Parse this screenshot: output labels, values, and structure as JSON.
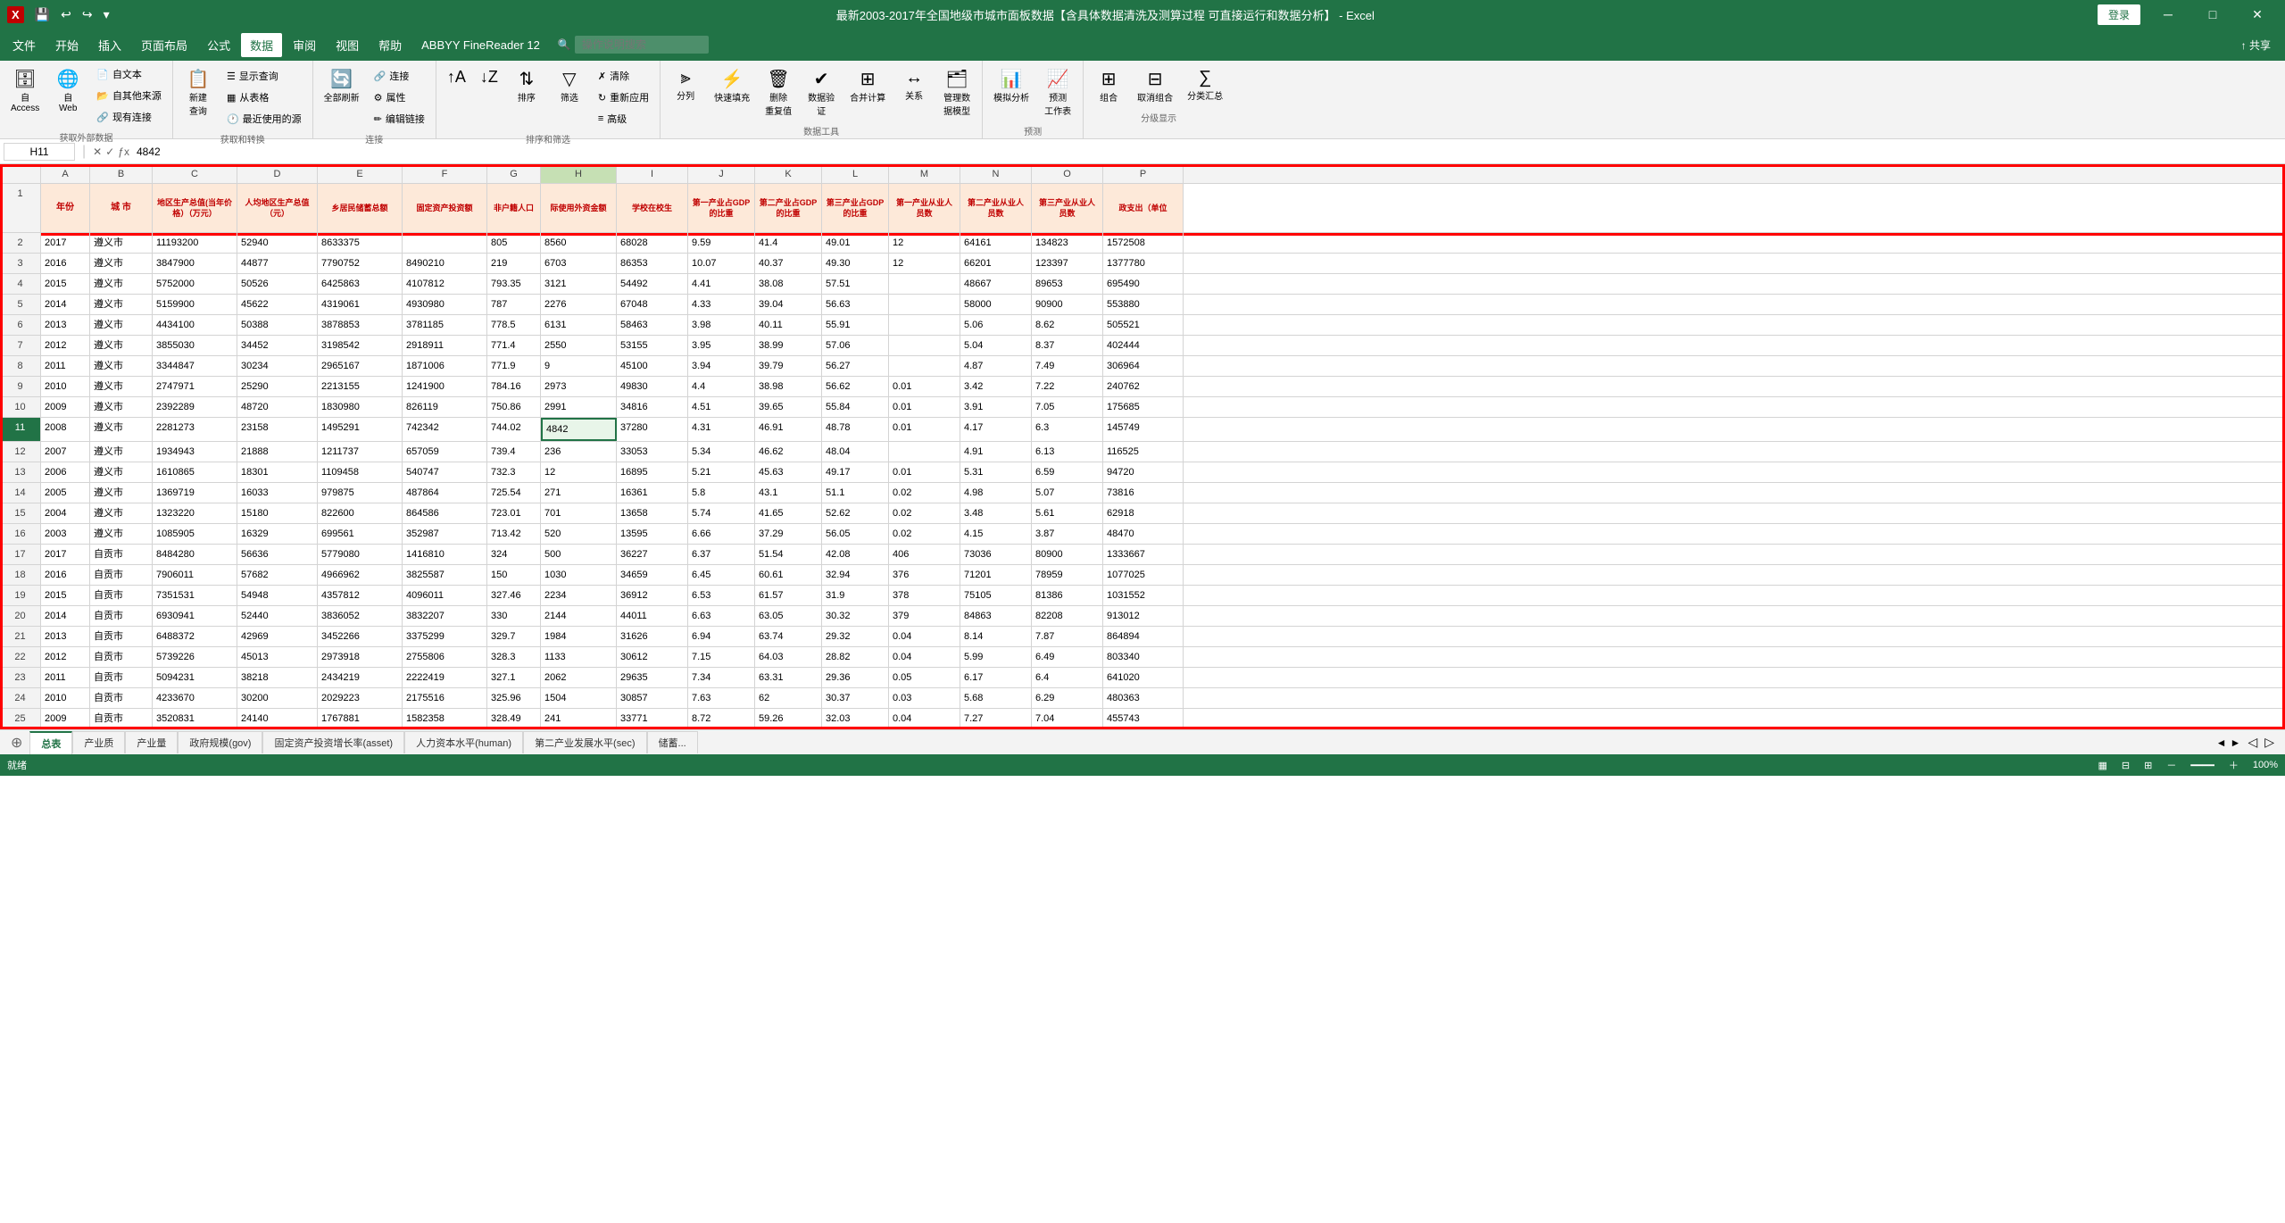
{
  "titleBar": {
    "title": "最新2003-2017年全国地级市城市面板数据【含具体数据清洗及测算过程 可直接运行和数据分析】 - Excel",
    "loginBtn": "登录",
    "windowControls": [
      "─",
      "□",
      "✕"
    ]
  },
  "menuBar": {
    "items": [
      "文件",
      "开始",
      "插入",
      "页面布局",
      "公式",
      "数据",
      "审阅",
      "视图",
      "帮助",
      "ABBYY FineReader 12",
      "操作说明搜索"
    ]
  },
  "ribbon": {
    "groups": [
      {
        "label": "获取外部数据",
        "buttons": [
          {
            "id": "access-btn",
            "icon": "🗄",
            "label": "自\nAccess"
          },
          {
            "id": "web-btn",
            "icon": "🌐",
            "label": "自\nWeb"
          },
          {
            "id": "text-btn",
            "icon": "📄",
            "label": "自文本"
          },
          {
            "id": "other-btn",
            "icon": "📂",
            "label": "自其他来源"
          },
          {
            "id": "existing-btn",
            "icon": "🔗",
            "label": "现有连接"
          }
        ]
      },
      {
        "label": "获取和转换",
        "buttons": [
          {
            "id": "new-query-btn",
            "icon": "📋",
            "label": "新建\n查询"
          },
          {
            "id": "show-query-btn",
            "label": "显示查询"
          },
          {
            "id": "from-table-btn",
            "label": "从表格"
          },
          {
            "id": "recent-btn",
            "label": "最近使用的源"
          }
        ]
      },
      {
        "label": "连接",
        "buttons": [
          {
            "id": "connect-btn",
            "label": "连接"
          },
          {
            "id": "props-btn",
            "label": "属性"
          },
          {
            "id": "edit-link-btn",
            "label": "编辑链接"
          },
          {
            "id": "refresh-all-btn",
            "icon": "🔄",
            "label": "全部刷新"
          }
        ]
      },
      {
        "label": "排序和筛选",
        "buttons": [
          {
            "id": "sort-asc-btn",
            "icon": "↑",
            "label": ""
          },
          {
            "id": "sort-desc-btn",
            "icon": "↓",
            "label": ""
          },
          {
            "id": "sort-btn",
            "icon": "⇅",
            "label": "排序"
          },
          {
            "id": "filter-btn",
            "icon": "▽",
            "label": "筛选"
          },
          {
            "id": "clear-btn",
            "label": "清除"
          },
          {
            "id": "reapply-btn",
            "label": "重新应用"
          },
          {
            "id": "advanced-btn",
            "label": "高级"
          }
        ]
      },
      {
        "label": "数据工具",
        "buttons": [
          {
            "id": "split-btn",
            "label": "分列"
          },
          {
            "id": "fill-btn",
            "label": "快速填充"
          },
          {
            "id": "remove-dup-btn",
            "label": "删除\n重复值"
          },
          {
            "id": "validate-btn",
            "label": "数据验\n证"
          },
          {
            "id": "consolidate-btn",
            "label": "合并计算"
          },
          {
            "id": "relations-btn",
            "label": "关系"
          },
          {
            "id": "manage-model-btn",
            "label": "管理数\n据模型"
          }
        ]
      },
      {
        "label": "预测",
        "buttons": [
          {
            "id": "what-if-btn",
            "label": "模拟分析"
          },
          {
            "id": "forecast-btn",
            "label": "预测\n工作表"
          }
        ]
      },
      {
        "label": "分级显示",
        "buttons": [
          {
            "id": "group-btn",
            "label": "组合"
          },
          {
            "id": "ungroup-btn",
            "label": "取消组合"
          },
          {
            "id": "subtotal-btn",
            "label": "分类汇总"
          }
        ]
      }
    ]
  },
  "formulaBar": {
    "cellRef": "H11",
    "formula": "4842"
  },
  "columns": [
    "A",
    "B",
    "C",
    "D",
    "E",
    "F",
    "G",
    "H",
    "I",
    "J",
    "K",
    "L",
    "M",
    "N",
    "O",
    "P"
  ],
  "headers": {
    "row1": [
      "年份",
      "城 市",
      "地区生产总值(当年价格）（万元）",
      "人均地区生产总值（元）",
      "乡居民储蓄总额",
      "固定资产投资额",
      "非户籍人口",
      "际使用外资金额",
      "学校在校生",
      "第一产业占GDP的比重",
      "第二产业占GDP的比重",
      "第三产业占GDP的比重",
      "第一产业从业人员数",
      "第二产业从业人员数",
      "第三产业从业人员数",
      "政支出（单位"
    ]
  },
  "rows": [
    {
      "num": 2,
      "cells": [
        "2017",
        "遵义市",
        "11193200",
        "52940",
        "8633375",
        "",
        "805",
        "8560",
        "68028",
        "9.59",
        "41.4",
        "49.01",
        "12",
        "64161",
        "134823",
        "1572508"
      ]
    },
    {
      "num": 3,
      "cells": [
        "2016",
        "遵义市",
        "3847900",
        "44877",
        "7790752",
        "8490210",
        "219",
        "6703",
        "86353",
        "10.07",
        "40.37",
        "49.30",
        "12",
        "66201",
        "123397",
        "1377780"
      ]
    },
    {
      "num": 4,
      "cells": [
        "2015",
        "遵义市",
        "5752000",
        "50526",
        "6425863",
        "4107812",
        "793.35",
        "3121",
        "54492",
        "4.41",
        "38.08",
        "57.51",
        "",
        "48667",
        "89653",
        "695490"
      ]
    },
    {
      "num": 5,
      "cells": [
        "2014",
        "遵义市",
        "5159900",
        "45622",
        "4319061",
        "4930980",
        "787",
        "2276",
        "67048",
        "4.33",
        "39.04",
        "56.63",
        "",
        "58000",
        "90900",
        "553880"
      ]
    },
    {
      "num": 6,
      "cells": [
        "2013",
        "遵义市",
        "4434100",
        "50388",
        "3878853",
        "3781185",
        "778.5",
        "6131",
        "58463",
        "3.98",
        "40.11",
        "55.91",
        "",
        "5.06",
        "8.62",
        "505521"
      ]
    },
    {
      "num": 7,
      "cells": [
        "2012",
        "遵义市",
        "3855030",
        "34452",
        "3198542",
        "2918911",
        "771.4",
        "2550",
        "53155",
        "3.95",
        "38.99",
        "57.06",
        "",
        "5.04",
        "8.37",
        "402444"
      ]
    },
    {
      "num": 8,
      "cells": [
        "2011",
        "遵义市",
        "3344847",
        "30234",
        "2965167",
        "1871006",
        "771.9",
        "9",
        "45100",
        "3.94",
        "39.79",
        "56.27",
        "",
        "4.87",
        "7.49",
        "306964"
      ]
    },
    {
      "num": 9,
      "cells": [
        "2010",
        "遵义市",
        "2747971",
        "25290",
        "2213155",
        "1241900",
        "784.16",
        "2973",
        "49830",
        "4.4",
        "38.98",
        "56.62",
        "0.01",
        "3.42",
        "7.22",
        "240762"
      ]
    },
    {
      "num": 10,
      "cells": [
        "2009",
        "遵义市",
        "2392289",
        "48720",
        "1830980",
        "826119",
        "750.86",
        "2991",
        "34816",
        "4.51",
        "39.65",
        "55.84",
        "0.01",
        "3.91",
        "7.05",
        "175685"
      ]
    },
    {
      "num": 11,
      "cells": [
        "2008",
        "遵义市",
        "2281273",
        "23158",
        "1495291",
        "742342",
        "744.02",
        "4842",
        "37280",
        "4.31",
        "46.91",
        "48.78",
        "0.01",
        "4.17",
        "6.3",
        "145749"
      ],
      "active": true
    },
    {
      "num": 12,
      "cells": [
        "2007",
        "遵义市",
        "1934943",
        "21888",
        "1211737",
        "657059",
        "739.4",
        "236",
        "33053",
        "5.34",
        "46.62",
        "48.04",
        "",
        "4.91",
        "6.13",
        "116525"
      ]
    },
    {
      "num": 13,
      "cells": [
        "2006",
        "遵义市",
        "1610865",
        "18301",
        "1109458",
        "540747",
        "732.3",
        "12",
        "16895",
        "5.21",
        "45.63",
        "49.17",
        "0.01",
        "5.31",
        "6.59",
        "94720"
      ]
    },
    {
      "num": 14,
      "cells": [
        "2005",
        "遵义市",
        "1369719",
        "16033",
        "979875",
        "487864",
        "725.54",
        "271",
        "16361",
        "5.8",
        "43.1",
        "51.1",
        "0.02",
        "4.98",
        "5.07",
        "73816"
      ]
    },
    {
      "num": 15,
      "cells": [
        "2004",
        "遵义市",
        "1323220",
        "15180",
        "822600",
        "864586",
        "723.01",
        "701",
        "13658",
        "5.74",
        "41.65",
        "52.62",
        "0.02",
        "3.48",
        "5.61",
        "62918"
      ]
    },
    {
      "num": 16,
      "cells": [
        "2003",
        "遵义市",
        "1085905",
        "16329",
        "699561",
        "352987",
        "713.42",
        "520",
        "13595",
        "6.66",
        "37.29",
        "56.05",
        "0.02",
        "4.15",
        "3.87",
        "48470"
      ]
    },
    {
      "num": 17,
      "cells": [
        "2017",
        "自贡市",
        "8484280",
        "56636",
        "5779080",
        "1416810",
        "324",
        "500",
        "36227",
        "6.37",
        "51.54",
        "42.08",
        "406",
        "73036",
        "80900",
        "1333667"
      ]
    },
    {
      "num": 18,
      "cells": [
        "2016",
        "自贡市",
        "7906011",
        "57682",
        "4966962",
        "3825587",
        "150",
        "1030",
        "34659",
        "6.45",
        "60.61",
        "32.94",
        "376",
        "71201",
        "78959",
        "1077025"
      ]
    },
    {
      "num": 19,
      "cells": [
        "2015",
        "自贡市",
        "7351531",
        "54948",
        "4357812",
        "4096011",
        "327.46",
        "2234",
        "36912",
        "6.53",
        "61.57",
        "31.9",
        "378",
        "75105",
        "81386",
        "1031552"
      ]
    },
    {
      "num": 20,
      "cells": [
        "2014",
        "自贡市",
        "6930941",
        "52440",
        "3836052",
        "3832207",
        "330",
        "2144",
        "44011",
        "6.63",
        "63.05",
        "30.32",
        "379",
        "84863",
        "82208",
        "913012"
      ]
    },
    {
      "num": 21,
      "cells": [
        "2013",
        "自贡市",
        "6488372",
        "42969",
        "3452266",
        "3375299",
        "329.7",
        "1984",
        "31626",
        "6.94",
        "63.74",
        "29.32",
        "0.04",
        "8.14",
        "7.87",
        "864894"
      ]
    },
    {
      "num": 22,
      "cells": [
        "2012",
        "自贡市",
        "5739226",
        "45013",
        "2973918",
        "2755806",
        "328.3",
        "1133",
        "30612",
        "7.15",
        "64.03",
        "28.82",
        "0.04",
        "5.99",
        "6.49",
        "803340"
      ]
    },
    {
      "num": 23,
      "cells": [
        "2011",
        "自贡市",
        "5094231",
        "38218",
        "2434219",
        "2222419",
        "327.1",
        "2062",
        "29635",
        "7.34",
        "63.31",
        "29.36",
        "0.05",
        "6.17",
        "6.4",
        "641020"
      ]
    },
    {
      "num": 24,
      "cells": [
        "2010",
        "自贡市",
        "4233670",
        "30200",
        "2029223",
        "2175516",
        "325.96",
        "1504",
        "30857",
        "7.63",
        "62",
        "30.37",
        "0.03",
        "5.68",
        "6.29",
        "480363"
      ]
    },
    {
      "num": 25,
      "cells": [
        "2009",
        "自贡市",
        "3520831",
        "24140",
        "1767881",
        "1582358",
        "328.49",
        "241",
        "33771",
        "8.72",
        "59.26",
        "32.03",
        "0.04",
        "7.27",
        "7.04",
        "455743"
      ]
    }
  ],
  "sheetTabs": {
    "tabs": [
      "总表",
      "产业质",
      "产业量",
      "政府规模(gov)",
      "固定资产投资增长率(asset)",
      "人力资本水平(human)",
      "第二产业发展水平(sec)",
      "储蓄..."
    ],
    "active": "总表"
  },
  "statusBar": {
    "left": "就绪",
    "zoom": "100%"
  }
}
